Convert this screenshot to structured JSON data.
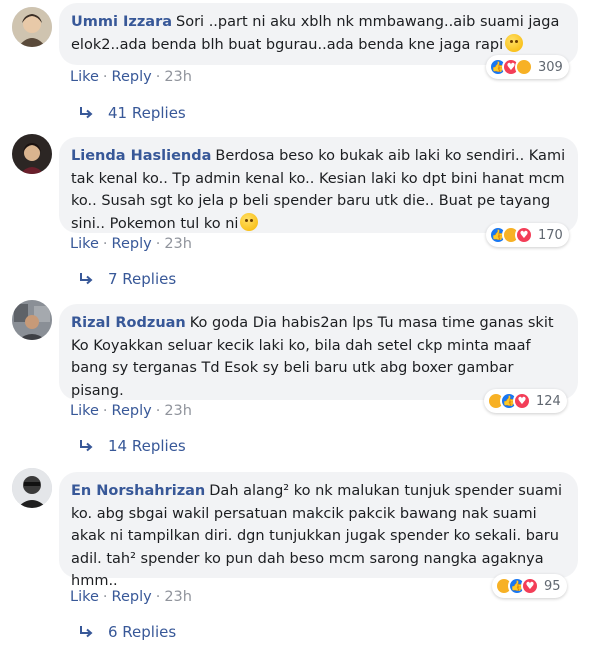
{
  "comments": [
    {
      "author": "Ummi Izzara",
      "text": "Sori ..part ni aku xblh nk mmbawang..aib suami jaga elok2..ada benda blh buat bgurau..ada benda kne jaga rapi",
      "like_label": "Like",
      "reply_label": "Reply",
      "time": "23h",
      "reaction_icons": [
        "like-icon",
        "love-icon",
        "sad-icon"
      ],
      "reaction_count": "309",
      "replies_label": "41 Replies"
    },
    {
      "author": "Lienda Haslienda",
      "text": "Berdosa beso ko bukak aib laki ko sendiri.. Kami tak kenal ko.. Tp admin kenal ko.. Kesian laki ko dpt bini hanat mcm ko.. Susah sgt ko jela p beli spender baru utk die.. Buat pe tayang sini.. Pokemon tul ko ni",
      "like_label": "Like",
      "reply_label": "Reply",
      "time": "23h",
      "reaction_icons": [
        "like-icon",
        "haha-icon",
        "love-icon"
      ],
      "reaction_count": "170",
      "replies_label": "7 Replies"
    },
    {
      "author": "Rizal Rodzuan",
      "text": "Ko goda Dia habis2an lps Tu masa time ganas skit Ko Koyakkan seluar kecik laki ko, bila dah setel ckp minta maaf bang sy terganas Td Esok sy beli baru utk abg boxer gambar pisang.",
      "like_label": "Like",
      "reply_label": "Reply",
      "time": "23h",
      "reaction_icons": [
        "haha-icon",
        "like-icon",
        "love-icon"
      ],
      "reaction_count": "124",
      "replies_label": "14 Replies"
    },
    {
      "author": "En Norshahrizan",
      "text": "Dah alang² ko nk malukan tunjuk spender suami ko. abg sbgai wakil persatuan makcik pakcik bawang nak suami akak ni tampilkan diri. dgn tunjukkan jugak spender ko sekali. baru adil. tah² spender ko pun dah beso mcm sarong nangka agaknya hmm..",
      "like_label": "Like",
      "reply_label": "Reply",
      "time": "23h",
      "reaction_icons": [
        "haha-icon",
        "like-icon",
        "love-icon"
      ],
      "reaction_count": "95",
      "replies_label": "6 Replies"
    }
  ],
  "colors": {
    "author": "#385898",
    "bubble": "#f2f3f5",
    "link": "#385898",
    "meta": "#90949c"
  }
}
